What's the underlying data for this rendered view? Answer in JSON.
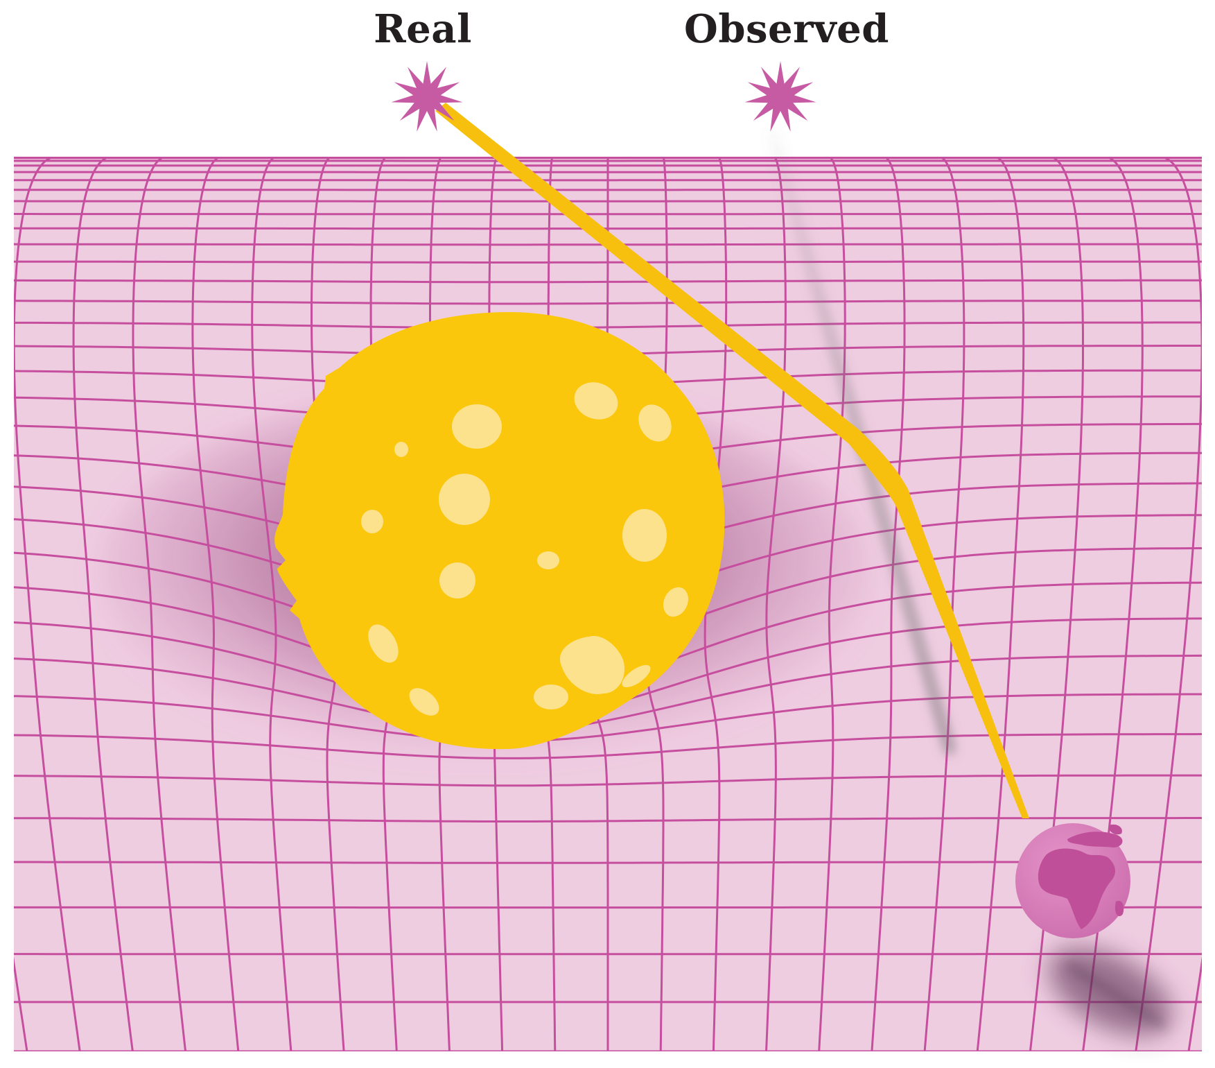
{
  "labels": {
    "real": "Real",
    "observed": "Observed"
  },
  "colors": {
    "background": "#ffffff",
    "fabric": "#efcde1",
    "grid_line": "#c64e9e",
    "star": "#c65aa3",
    "light_ray": "#f7c00f",
    "mass_body": "#fbc70d",
    "mass_spots": "#fde28e",
    "earth": "#d97cba",
    "earth_land": "#c04f99",
    "shadow": "#6f2f5c"
  },
  "icons": {
    "real_star": "star-burst-icon",
    "observed_star": "star-burst-icon",
    "massive_body": "sun-sphere-icon",
    "observer": "earth-globe-icon"
  }
}
